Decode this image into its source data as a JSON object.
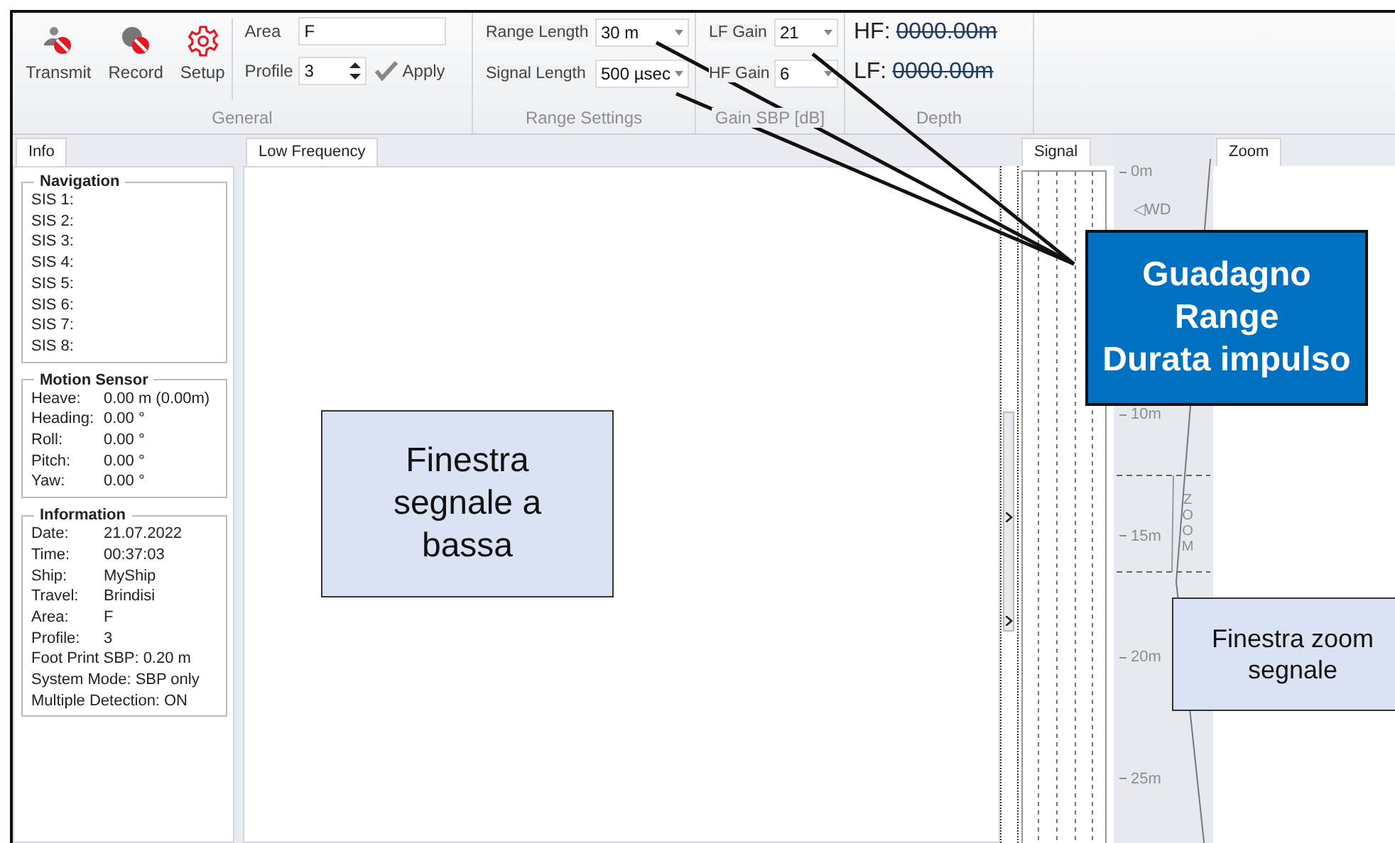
{
  "ribbon": {
    "buttons": [
      {
        "label": "Transmit",
        "kind": "transmit"
      },
      {
        "label": "Record",
        "kind": "record"
      },
      {
        "label": "Setup",
        "kind": "setup"
      }
    ],
    "area": {
      "label": "Area",
      "value": "F"
    },
    "profile": {
      "label": "Profile",
      "value": "3"
    },
    "apply": "Apply",
    "range_length": {
      "label": "Range Length",
      "value": "30 m"
    },
    "signal_length": {
      "label": "Signal Length",
      "value": "500 µsec"
    },
    "lf_gain": {
      "label": "LF Gain",
      "value": "21"
    },
    "hf_gain": {
      "label": "HF Gain",
      "value": "6"
    },
    "depth": [
      {
        "label": "HF:",
        "value": "0000.00m"
      },
      {
        "label": "LF:",
        "value": "0000.00m"
      }
    ],
    "groups": [
      "General",
      "Range Settings",
      "Gain SBP [dB]",
      "Depth"
    ]
  },
  "info_panel": {
    "tab": "Info",
    "sections": [
      {
        "title": "Navigation",
        "rows": [
          {
            "label": "SIS 1:"
          },
          {
            "label": "SIS 2:"
          },
          {
            "label": "SIS 3:"
          },
          {
            "label": "SIS 4:"
          },
          {
            "label": "SIS 5:"
          },
          {
            "label": "SIS 6:"
          },
          {
            "label": "SIS 7:"
          },
          {
            "label": "SIS 8:"
          }
        ]
      },
      {
        "title": "Motion Sensor",
        "rows": [
          {
            "label": "Heave:",
            "value": "0.00 m (0.00m)"
          },
          {
            "label": "Heading:",
            "value": "0.00 °"
          },
          {
            "label": "Roll:",
            "value": "0.00 °"
          },
          {
            "label": "Pitch:",
            "value": "0.00 °"
          },
          {
            "label": "Yaw:",
            "value": "0.00 °"
          }
        ]
      },
      {
        "title": "Information",
        "rows": [
          {
            "label": "Date:",
            "value": "21.07.2022"
          },
          {
            "label": "Time:",
            "value": "00:37:03"
          },
          {
            "label": "Ship:",
            "value": "MyShip"
          },
          {
            "label": "Travel:",
            "value": "Brindisi"
          },
          {
            "label": "Area:",
            "value": "F"
          },
          {
            "label": "Profile:",
            "value": "3"
          },
          {
            "label": "Foot Print SBP:",
            "value": "0.20 m"
          },
          {
            "label": "System Mode:",
            "value": "SBP only"
          },
          {
            "label": "Multiple Detection:",
            "value": "ON"
          }
        ]
      }
    ]
  },
  "low_frequency": {
    "tab": "Low Frequency"
  },
  "signal": {
    "tab": "Signal"
  },
  "scale": {
    "ticks": [
      "0m",
      "10m",
      "15m",
      "20m",
      "25m"
    ],
    "marker": "◁WD",
    "zoom_label": "ZOOM"
  },
  "zoom": {
    "tab": "Zoom"
  },
  "callouts": [
    {
      "text": "Finestra\nsegnale a\nbassa",
      "kind": "light"
    },
    {
      "text": "Guadagno\nRange\nDurata impulso",
      "kind": "blue"
    },
    {
      "text": "Finestra zoom\nsegnale",
      "kind": "light"
    }
  ]
}
